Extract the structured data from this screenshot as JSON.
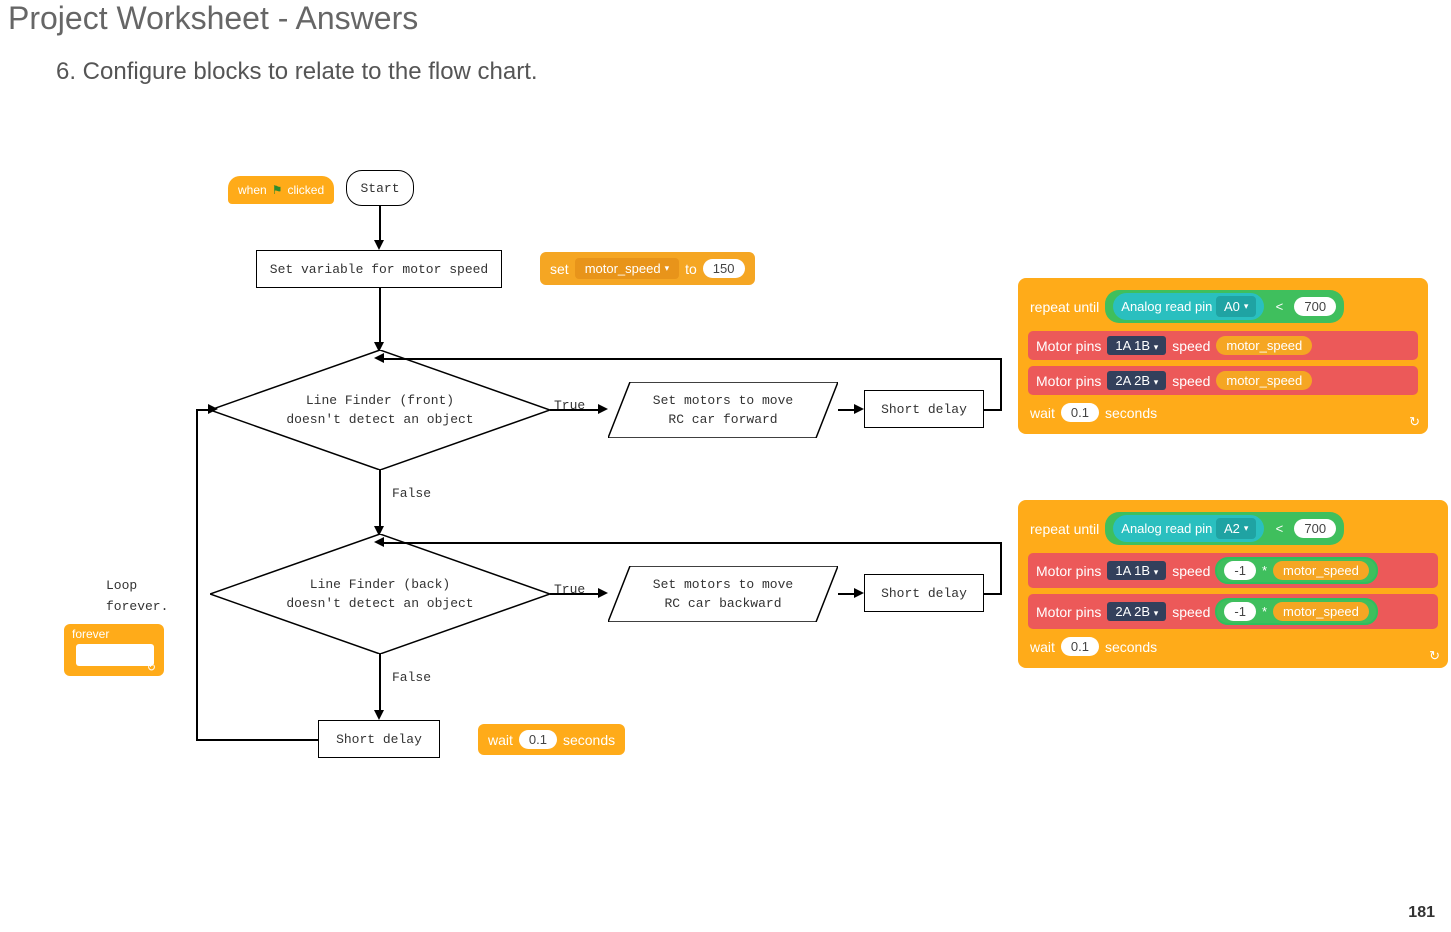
{
  "page": {
    "title": "Project Worksheet - Answers",
    "instruction": "6. Configure blocks to relate to the flow chart.",
    "page_number": "181"
  },
  "flowchart": {
    "start": "Start",
    "set_var": "Set variable for motor speed",
    "decision1_line1": "Line Finder (front)",
    "decision1_line2": "doesn't detect an object",
    "decision2_line1": "Line Finder (back)",
    "decision2_line2": "doesn't detect an object",
    "true": "True",
    "false": "False",
    "proc_forward_line1": "Set motors to move",
    "proc_forward_line2": "RC car forward",
    "proc_backward_line1": "Set motors to move",
    "proc_backward_line2": "RC car backward",
    "short_delay": "Short delay",
    "loop_forever_line1": "Loop",
    "loop_forever_line2": "forever."
  },
  "blocks": {
    "when_clicked": "when",
    "clicked": "clicked",
    "set": "set",
    "motor_speed": "motor_speed",
    "to": "to",
    "speed_val": "150",
    "forever": "forever",
    "wait": "wait",
    "wait_val": "0.1",
    "seconds": "seconds",
    "repeat_until": "repeat until",
    "analog_read": "Analog read pin",
    "pin_A0": "A0",
    "pin_A2": "A2",
    "threshold": "700",
    "motor_pins": "Motor pins",
    "pins_1A1B": "1A 1B",
    "pins_2A2B": "2A 2B",
    "speed_lbl": "speed",
    "neg1": "-1",
    "star": "*"
  }
}
